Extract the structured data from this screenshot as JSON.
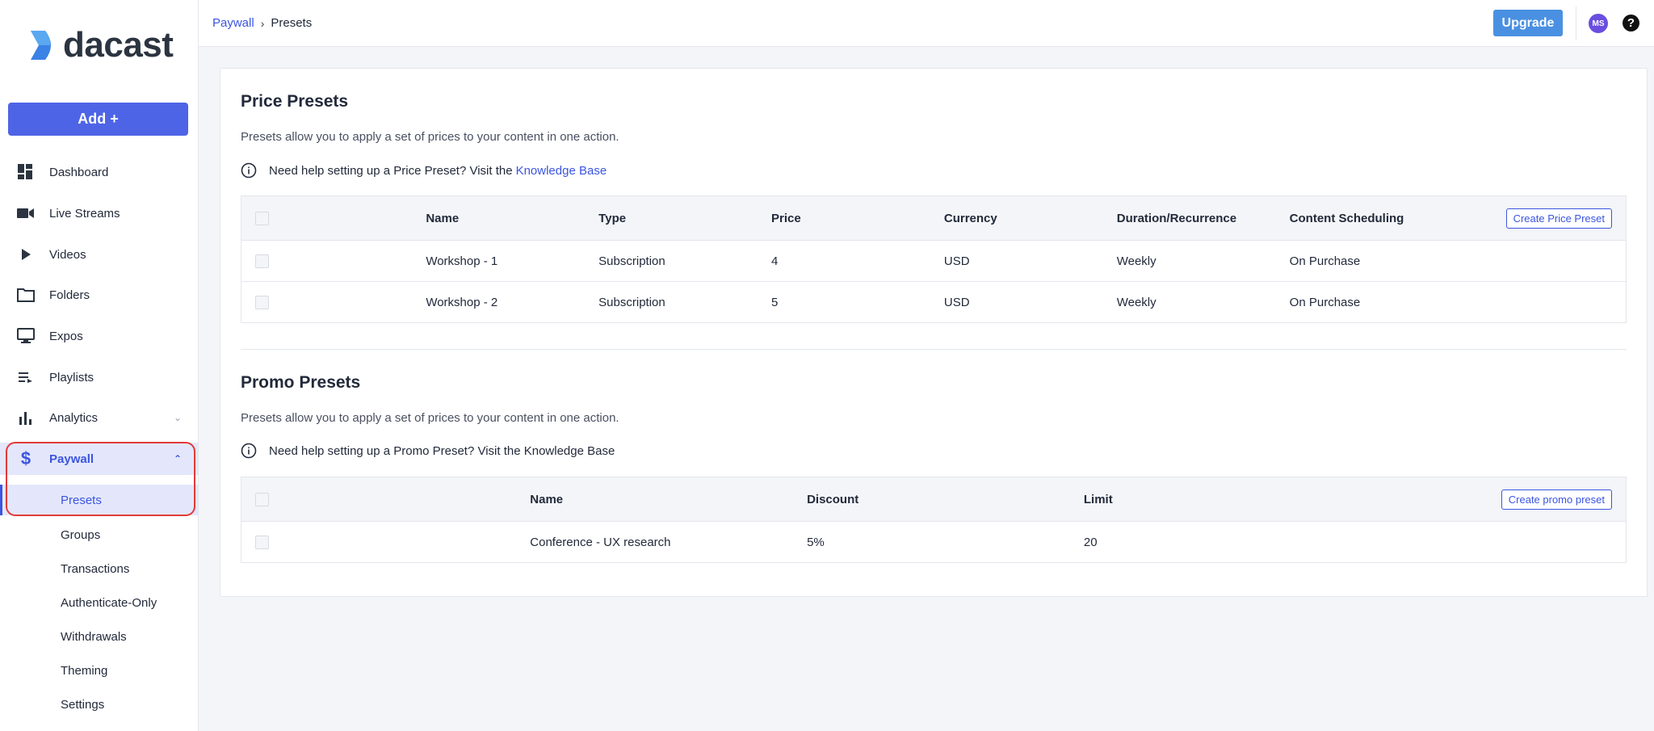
{
  "app": {
    "logo_text": "dacast",
    "add_label": "Add +"
  },
  "sidebar": {
    "items": [
      {
        "label": "Dashboard",
        "icon": "dashboard-icon"
      },
      {
        "label": "Live Streams",
        "icon": "video-camera-icon"
      },
      {
        "label": "Videos",
        "icon": "play-icon"
      },
      {
        "label": "Folders",
        "icon": "folder-icon"
      },
      {
        "label": "Expos",
        "icon": "monitor-icon"
      },
      {
        "label": "Playlists",
        "icon": "playlist-icon"
      },
      {
        "label": "Analytics",
        "icon": "bar-chart-icon"
      },
      {
        "label": "Paywall",
        "icon": "dollar-icon"
      }
    ],
    "paywall_sub": [
      "Presets",
      "Groups",
      "Transactions",
      "Authenticate-Only",
      "Withdrawals",
      "Theming",
      "Settings"
    ]
  },
  "header": {
    "breadcrumb": {
      "parent": "Paywall",
      "current": "Presets"
    },
    "upgrade_label": "Upgrade",
    "avatar_initials": "MS",
    "help_glyph": "?"
  },
  "price_presets": {
    "title": "Price Presets",
    "description": "Presets allow you to apply a set of prices to your content in one action.",
    "help_text": "Need help setting up a Price Preset? Visit the",
    "help_link": "Knowledge Base",
    "columns": [
      "Name",
      "Type",
      "Price",
      "Currency",
      "Duration/Recurrence",
      "Content Scheduling"
    ],
    "create_label": "Create Price Preset",
    "rows": [
      [
        "Workshop - 1",
        "Subscription",
        "4",
        "USD",
        "Weekly",
        "On Purchase"
      ],
      [
        "Workshop - 2",
        "Subscription",
        "5",
        "USD",
        "Weekly",
        "On Purchase"
      ]
    ]
  },
  "promo_presets": {
    "title": "Promo Presets",
    "description": "Presets allow you to apply a set of prices to your content in one action.",
    "help_text": "Need help setting up a Promo Preset? Visit the Knowledge Base",
    "columns": [
      "Name",
      "Discount",
      "Limit"
    ],
    "create_label": "Create promo preset",
    "rows": [
      [
        "Conference - UX research",
        "5%",
        "20"
      ]
    ]
  },
  "colors": {
    "accent": "#3b55e0",
    "add_button": "#4e64e6",
    "upgrade_button": "#4a90e2",
    "highlight": "#e23a3a"
  }
}
